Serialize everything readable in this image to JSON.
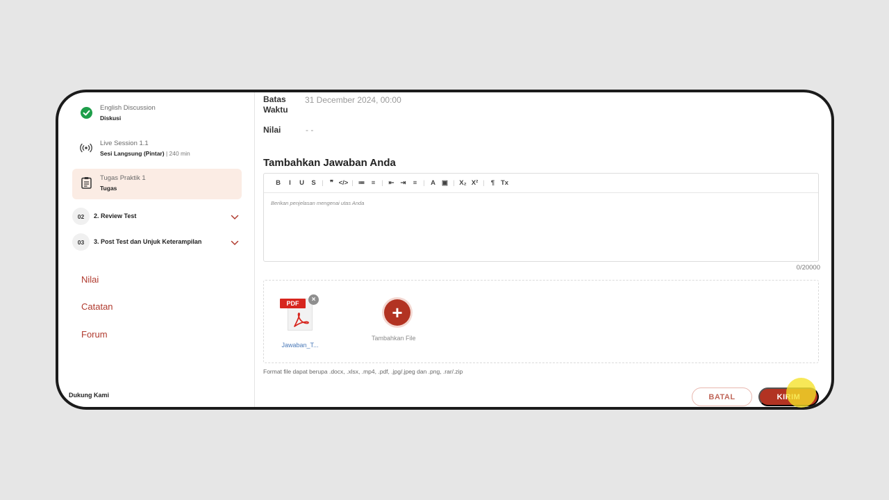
{
  "sidebar": {
    "lessons": [
      {
        "title": "English Discussion",
        "subtitle": "Diskusi",
        "extra": "",
        "icon": "check-circle-icon"
      },
      {
        "title": "Live Session 1.1",
        "subtitle": "Sesi Langsung (Pintar)",
        "extra": " | 240 min",
        "icon": "broadcast-icon"
      },
      {
        "title": "Tugas Praktik 1",
        "subtitle": "Tugas",
        "extra": "",
        "icon": "clipboard-icon"
      }
    ],
    "sections": [
      {
        "number": "02",
        "label": "2. Review Test"
      },
      {
        "number": "03",
        "label": "3. Post Test dan Unjuk Keterampilan"
      }
    ],
    "nav": {
      "nilai": "Nilai",
      "catatan": "Catatan",
      "forum": "Forum"
    },
    "support": "Dukung Kami"
  },
  "main": {
    "deadline_label_1": "Batas",
    "deadline_label_2": "Waktu",
    "deadline_value": "31 December 2024, 00:00",
    "score_label": "Nilai",
    "score_value": "- -",
    "answer_title": "Tambahkan Jawaban Anda",
    "editor_placeholder": "Berikan penjelasan mengenai utas Anda",
    "char_counter": "0/20000",
    "toolbar": [
      "B",
      "I",
      "U",
      "S",
      "|",
      "❞",
      "</>",
      "|",
      "≔",
      "≡",
      "|",
      "⇤",
      "⇥",
      "≡",
      "|",
      "A",
      "▣",
      "|",
      "X₂",
      "X²",
      "|",
      "¶",
      "Tx"
    ],
    "file": {
      "badge": "PDF",
      "name": "Jawaban_T...",
      "remove": "×"
    },
    "add_file": {
      "symbol": "+",
      "label": "Tambahkan File"
    },
    "file_hint": "Format file dapat berupa .docx, .xlsx, .mp4, .pdf, .jpg/.jpeg dan .png, .rar/.zip",
    "cancel_label": "BATAL",
    "send_label": "KIRIM"
  },
  "colors": {
    "accent": "#b23322",
    "active_bg": "#fbece4",
    "check_green": "#1e9e4a"
  }
}
